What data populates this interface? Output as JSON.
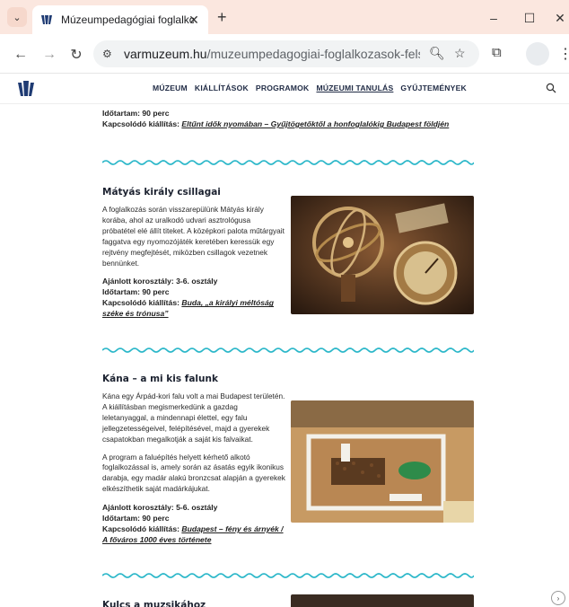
{
  "browser": {
    "tab_title": "Múzeumpedagógiai foglalkozá",
    "url_host": "varmuzeum.hu",
    "url_path": "/muzeumpedagogiai-foglalkozasok-felso-tago..."
  },
  "nav": {
    "items": [
      "MÚZEUM",
      "KIÁLLÍTÁSOK",
      "PROGRAMOK",
      "MÚZEUMI TANULÁS",
      "GYŰJTEMÉNYEK"
    ]
  },
  "top": {
    "duration": "Időtartam: 90 perc",
    "related_label": "Kapcsolódó kiállítás:",
    "related_link": "Eltűnt idők nyomában – Gyűjtögetőktől a honfoglalókig Budapest földjén"
  },
  "section1": {
    "title": "Mátyás király csillagai",
    "paragraph": "A foglalkozás során visszarepülünk Mátyás király korába, ahol az uralkodó udvari asztrológusa próbatétel elé állít titeket. A középkori palota műtárgyait faggatva egy nyomozójáték keretében keressük egy rejtvény megfejtését, miközben csillagok vezetnek bennünket.",
    "age": "Ajánlott korosztály: 3-6. osztály",
    "duration": "Időtartam: 90 perc",
    "related_label": "Kapcsolódó kiállítás:",
    "related_link": "Buda, „a királyi méltóság széke és trónusa”"
  },
  "section2": {
    "title": "Kána – a mi kis falunk",
    "paragraph1": "Kána egy Árpád-kori falu volt a mai Budapest területén. A kiállításban megismerkedünk a gazdag leletanyaggal, a mindennapi élettel, egy falu jellegzetességeivel, felépítésével, majd a gyerekek csapatokban megalkotják a saját kis falvaikat.",
    "paragraph2": "A program a faluépítés helyett kérhető alkotó foglalkozással is, amely során az ásatás egyik ikonikus darabja, egy madár alakú bronzcsat alapján a gyerekek elkészíthetik saját madárkájukat.",
    "age": "Ajánlott korosztály: 5-6. osztály",
    "duration": "Időtartam: 90 perc",
    "related_label": "Kapcsolódó kiállítás:",
    "related_link": "Budapest – fény és árnyék / A főváros 1000 éves története"
  },
  "section3": {
    "title": "Kulcs a muzsikához"
  },
  "colors": {
    "wave": "#2bb7c9",
    "tabbar": "#fbe7df",
    "logo": "#1f3b73"
  }
}
